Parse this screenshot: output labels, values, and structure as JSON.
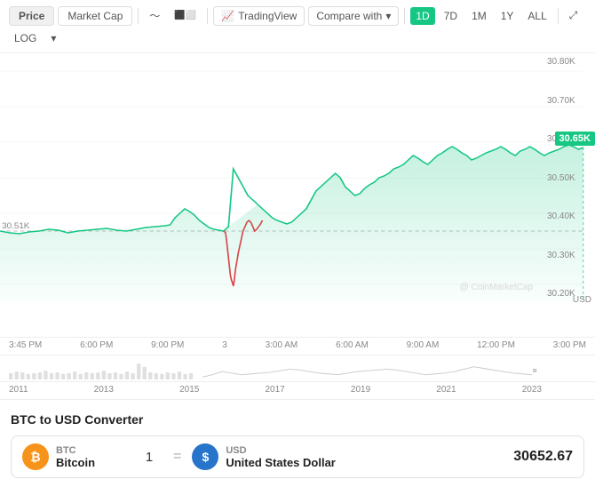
{
  "toolbar": {
    "price_label": "Price",
    "market_cap_label": "Market Cap",
    "tradingview_label": "TradingView",
    "compare_label": "Compare with",
    "time_options": [
      "1D",
      "7D",
      "1M",
      "1Y",
      "ALL"
    ],
    "active_time": "1D",
    "log_label": "LOG",
    "icons": {
      "line_icon": "〜",
      "candle_icon": "⬛",
      "expand_icon": "⤢",
      "dropdown_icon": "▾"
    }
  },
  "chart": {
    "y_axis": [
      "30.80K",
      "30.70K",
      "30.65K",
      "30.60K",
      "30.50K",
      "30.40K",
      "30.30K",
      "30.20K"
    ],
    "current_price": "30.65K",
    "watermark": "CoinMarketCap",
    "usd_label": "USD",
    "time_axis": [
      "3:45 PM",
      "6:00 PM",
      "9:00 PM",
      "3",
      "3:00 AM",
      "6:00 AM",
      "9:00 AM",
      "12:00 PM",
      "3:00 PM"
    ],
    "hist_time_axis": [
      "2011",
      "2013",
      "2015",
      "2017",
      "2019",
      "2021",
      "2023"
    ],
    "price_30_51": "30.51K"
  },
  "converter": {
    "title": "BTC to USD Converter",
    "btc_ticker": "BTC",
    "btc_name": "Bitcoin",
    "btc_icon_text": "₿",
    "amount": "1",
    "equals": "=",
    "usd_ticker": "USD",
    "usd_name": "United States Dollar",
    "usd_icon_text": "$",
    "converted_value": "30652.67"
  }
}
